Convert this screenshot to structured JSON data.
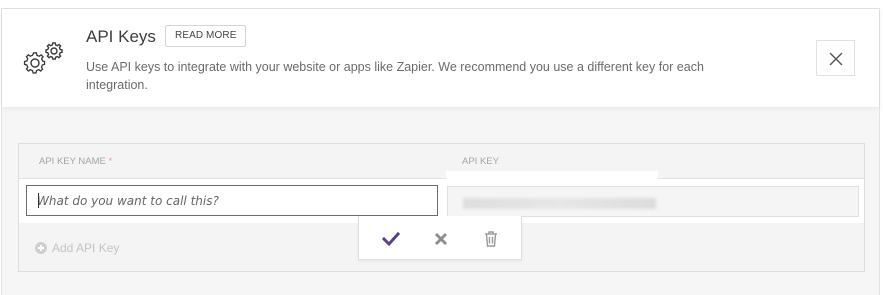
{
  "header": {
    "title": "API Keys",
    "read_more": "READ MORE",
    "description": "Use API keys to integrate with your website or apps like Zapier. We recommend you use a different key for each integration."
  },
  "table": {
    "columns": [
      {
        "label": "API KEY NAME",
        "required_marker": "*"
      },
      {
        "label": "API KEY"
      }
    ],
    "name_input": {
      "value": "",
      "placeholder": "What do you want to call this?"
    },
    "add_key_label": "Add API Key"
  },
  "icons": {
    "settings": "gears-icon",
    "close": "close-icon",
    "save": "check-icon",
    "cancel": "x-icon",
    "delete": "trash-icon",
    "add": "plus-circle-icon"
  },
  "colors": {
    "accent_check": "#5a3f8c",
    "muted_icon": "#9a9a9a",
    "required": "#e6a0a0"
  }
}
